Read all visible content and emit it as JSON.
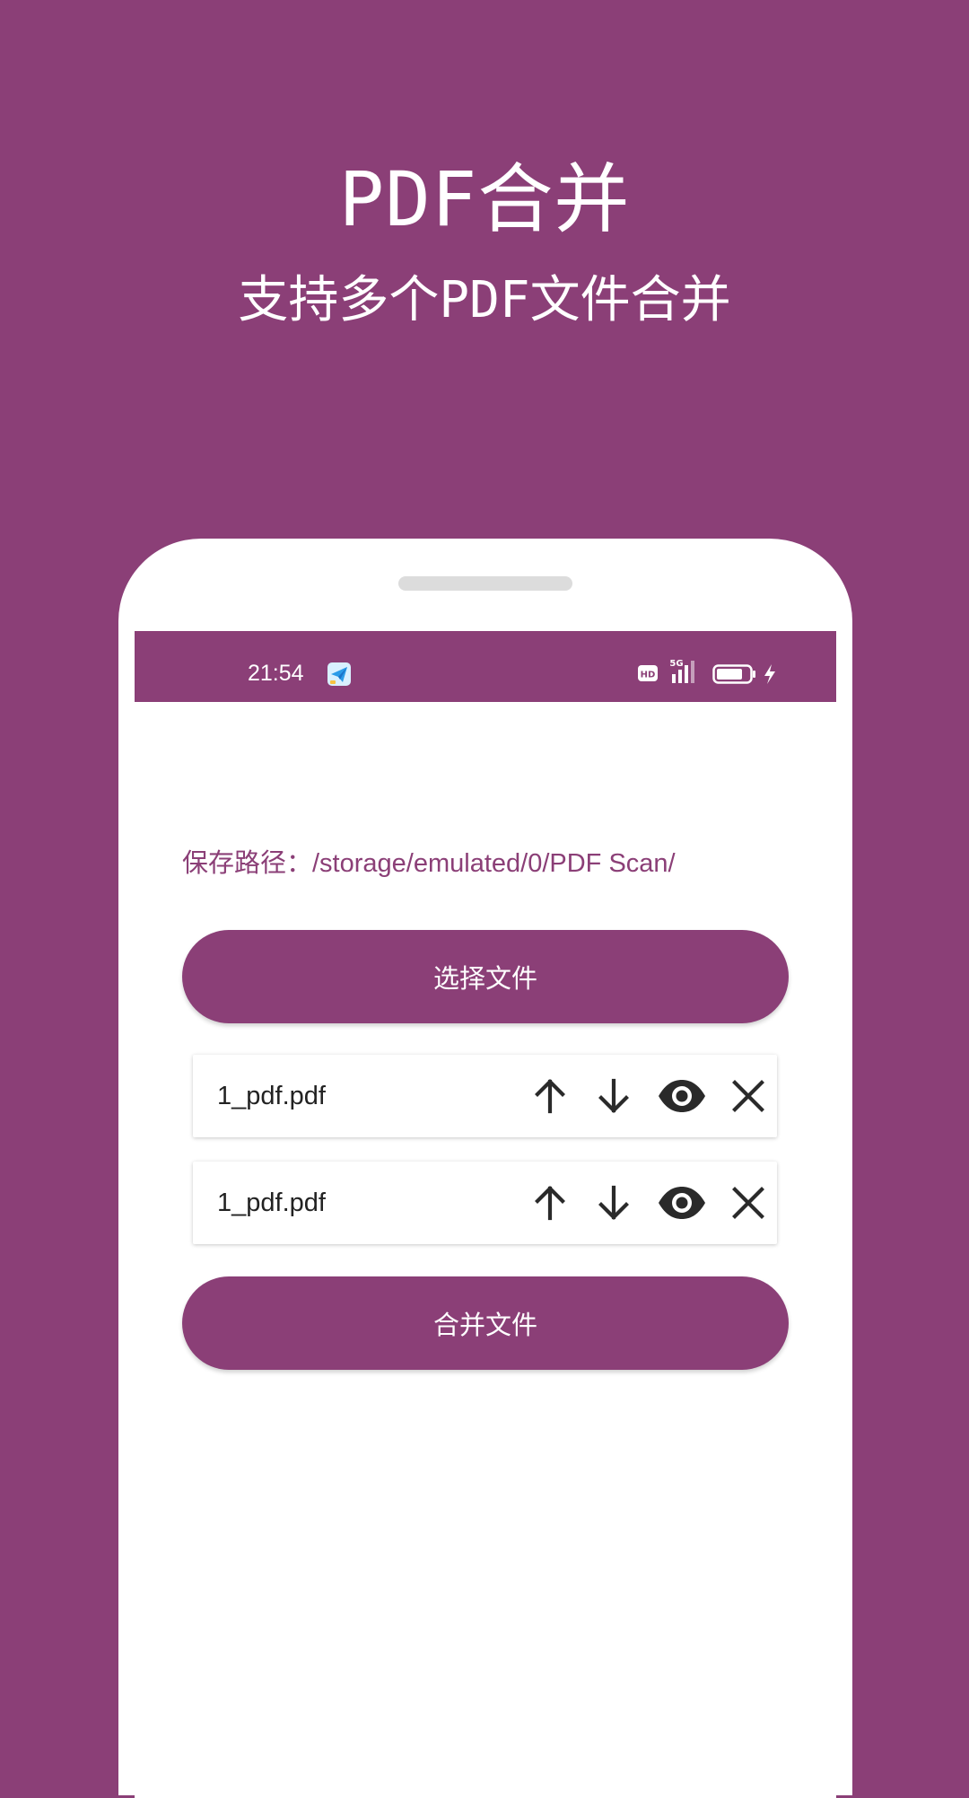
{
  "promo": {
    "title": "PDF合并",
    "subtitle": "支持多个PDF文件合并"
  },
  "statusbar": {
    "time": "21:54",
    "app_icon": "telegram-like-send-icon",
    "hd_label": "HD",
    "network_label": "5G",
    "icons": [
      "hd-icon",
      "5g-signal-icon",
      "battery-icon",
      "charging-icon"
    ]
  },
  "main": {
    "save_path": "保存路径：/storage/emulated/0/PDF Scan/",
    "select_button_label": "选择文件",
    "merge_button_label": "合并文件",
    "files": [
      {
        "name": "1_pdf.pdf",
        "actions": [
          "arrow-up-icon",
          "arrow-down-icon",
          "eye-icon",
          "close-icon"
        ]
      },
      {
        "name": "1_pdf.pdf",
        "actions": [
          "arrow-up-icon",
          "arrow-down-icon",
          "eye-icon",
          "close-icon"
        ]
      }
    ]
  },
  "colors": {
    "brand": "#8b3f77",
    "background": "#ffffff",
    "icon": "#2a2a2a"
  }
}
